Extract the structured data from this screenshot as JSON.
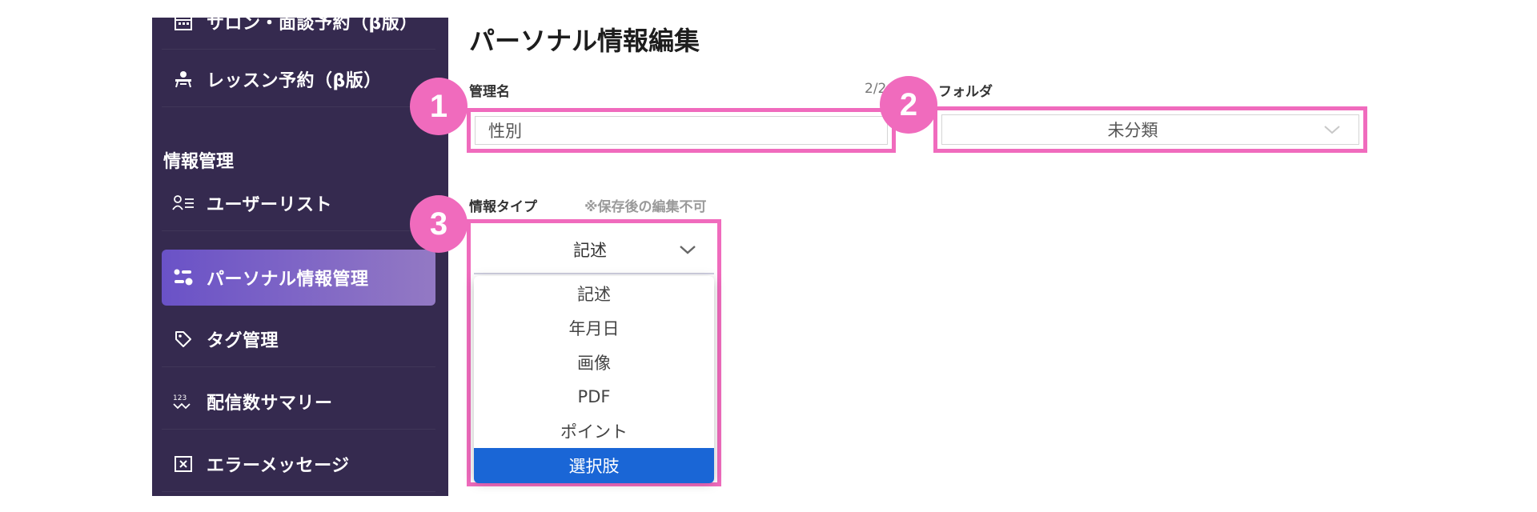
{
  "sidebar": {
    "section_title": "情報管理",
    "items": [
      {
        "label": "サロン・面談予約（β版）",
        "icon": "calendar-icon"
      },
      {
        "label": "レッスン予約（β版）",
        "icon": "lesson-icon"
      },
      {
        "label": "ユーザーリスト",
        "icon": "user-list-icon"
      },
      {
        "label": "パーソナル情報管理",
        "icon": "personal-info-icon",
        "active": true
      },
      {
        "label": "タグ管理",
        "icon": "tag-icon"
      },
      {
        "label": "配信数サマリー",
        "icon": "count-summary-icon"
      },
      {
        "label": "エラーメッセージ",
        "icon": "error-message-icon"
      }
    ]
  },
  "main": {
    "title": "パーソナル情報編集",
    "name_field": {
      "label": "管理名",
      "value": "性別",
      "counter": "2/2"
    },
    "folder_field": {
      "label": "フォルダ",
      "value": "未分類"
    },
    "type_field": {
      "label": "情報タイプ",
      "note": "※保存後の編集不可",
      "value": "記述",
      "options": [
        "記述",
        "年月日",
        "画像",
        "PDF",
        "ポイント",
        "選択肢"
      ],
      "highlighted_option": "選択肢"
    }
  },
  "annotations": {
    "badge1": "1",
    "badge2": "2",
    "badge3": "3"
  },
  "colors": {
    "sidebar_bg": "#352a4f",
    "highlight": "#f06bbd",
    "selected_option": "#1a66d6",
    "active_nav_start": "#6a52c7",
    "active_nav_end": "#9379c4"
  }
}
